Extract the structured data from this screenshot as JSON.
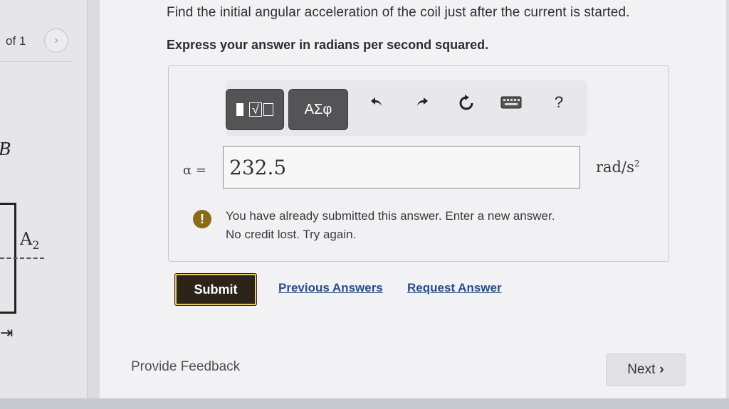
{
  "pager": {
    "text": "of 1",
    "next_icon": "chevron-right-icon",
    "next_glyph": "›"
  },
  "figure": {
    "b_label": "B",
    "b_arrow": "→",
    "a_label": "A",
    "a_sub": "2"
  },
  "question": {
    "line1": "Find the initial angular acceleration of the coil just after the current is started.",
    "line2": "Express your answer in radians per second squared."
  },
  "toolbar": {
    "templates_icon": "templates-icon",
    "greek_label": "ΑΣφ",
    "undo_icon": "undo-icon",
    "redo_icon": "redo-icon",
    "reset_icon": "reset-icon",
    "keyboard_icon": "keyboard-icon",
    "help_label": "?"
  },
  "answer": {
    "variable_label": "α =",
    "value": "232.5",
    "units": "rad/s",
    "units_exp": "2"
  },
  "warning": {
    "icon": "alert-icon",
    "mark": "!",
    "line1": "You have already submitted this answer. Enter a new answer.",
    "line2": "No credit lost. Try again."
  },
  "actions": {
    "submit_label": "Submit",
    "previous_answers_label": "Previous Answers",
    "request_answer_label": "Request Answer"
  },
  "footer": {
    "feedback_label": "Provide Feedback",
    "next_label": "Next",
    "next_glyph": "›"
  },
  "colors": {
    "submit_bg": "#2c2418",
    "submit_border": "#e8c96a",
    "link": "#2d4b86",
    "warning": "#8a6a16"
  }
}
